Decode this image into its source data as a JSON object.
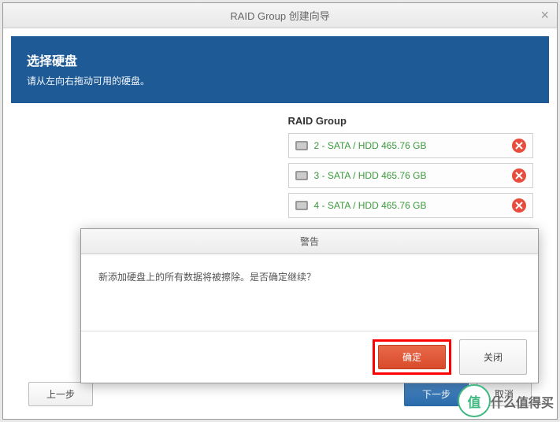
{
  "window": {
    "title": "RAID Group 创建向导"
  },
  "header": {
    "title": "选择硬盘",
    "subtitle": "请从左向右拖动可用的硬盘。"
  },
  "raidGroup": {
    "label": "RAID Group",
    "disks": [
      {
        "label": "2 - SATA / HDD 465.76 GB"
      },
      {
        "label": "3 - SATA / HDD 465.76 GB"
      },
      {
        "label": "4 - SATA / HDD 465.76 GB"
      }
    ]
  },
  "footer": {
    "prev": "上一步",
    "next": "下一步",
    "cancel": "取消"
  },
  "warning": {
    "title": "警告",
    "message": "新添加硬盘上的所有数据将被擦除。是否确定继续？",
    "confirm": "确定",
    "close": "关闭"
  },
  "watermark": {
    "badge": "值",
    "brand": "什么值得买"
  }
}
